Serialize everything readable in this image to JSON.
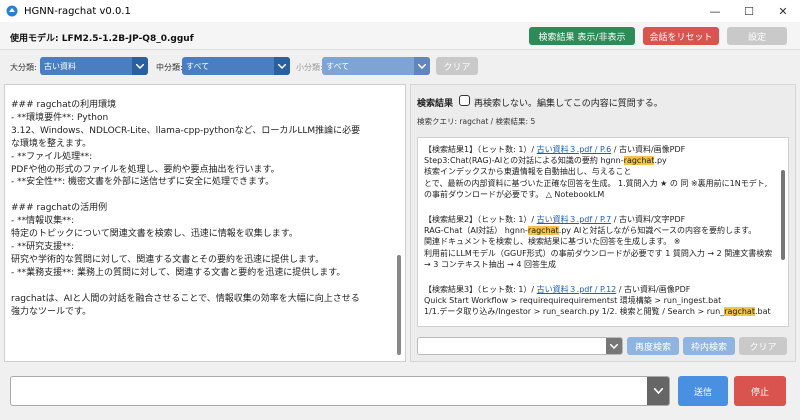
{
  "window": {
    "title": "HGNN-ragchat v0.0.1",
    "minimize": "—",
    "maximize": "☐",
    "close": "✕"
  },
  "toolbar": {
    "model_label": "使用モデル: LFM2.5-1.2B-JP-Q8_0.gguf",
    "toggle_results_label": "検索結果 表示/非表示",
    "reset_label": "会話をリセット",
    "settings_label": "設定"
  },
  "filters": {
    "major_label": "大分類:",
    "major_value": "古い資料",
    "middle_label": "中分類:",
    "middle_value": "すべて",
    "minor_label": "小分類:",
    "minor_value": "すべて",
    "clear_label": "クリア"
  },
  "answer": {
    "text": "### ragchatの利用環境\n- **環境要件**: Python\n3.12、Windows、NDLOCR-Lite、llama-cpp-pythonなど、ローカルLLM推論に必要\nな環境を整えます。\n- **ファイル処理**:\nPDFや他の形式のファイルを処理し、要約や要点抽出を行います。\n- **安全性**: 機密文書を外部に送信せずに安全に処理できます。\n\n### ragchatの活用例\n- **情報収集**:\n特定のトピックについて関連文書を検索し、迅速に情報を収集します。\n- **研究支援**:\n研究や学術的な質問に対して、関連する文書とその要約を迅速に提供します。\n- **業務支援**: 業務上の質問に対して、関連する文書と要約を迅速に提供します。\n\nragchatは、AIと人間の対話を融合させることで、情報収集の効率を大幅に向上させる\n強力なツールです。"
  },
  "results": {
    "heading": "検索結果",
    "checkbox_label": "再検索しない。編集してこの内容に質問する。",
    "query_info": "検索クエリ: ragchat / 検索結果: 5",
    "items": [
      {
        "prefix": "【検索結果1】（ヒット数: 1）/ ",
        "link": "古い資料３.pdf / P.6",
        "suffix": " / 古い資料/画像PDF",
        "l2a": "Step3:Chat(RAG)-AIとの対話による知識の要約 hgnn-",
        "l2hl": "ragchat",
        "l2b": ".py",
        "l3": "核索インデックスから東遺情報を自動抽出し、与えること",
        "l4": "とで、最新の内部資料に基づいた正確な回答を生成。 1.質問入力 ★ の 同 ※裏用前に1Nモデト,",
        "l5": "の事前ダウンロードが必要です。 △ NotebookLM"
      },
      {
        "prefix": "【検索結果2】（ヒット数: 1）/ ",
        "link": "古い資料３.pdf / P.7",
        "suffix": " / 古い資料/文字PDF",
        "l2a": "RAG-Chat（AI対話） hgnn-",
        "l2hl": "ragchat",
        "l2b": ".py AIと対話しながら知識ベースの内容を要約します。",
        "l3": "関連ドキュメントを検索し、検索結果に基づいた回答を生成します。 ※",
        "l4": "利用前にLLMモデル（GGUF形式）の事前ダウンロードが必要です 1 質問入力 → 2 関連文書検索",
        "l5": "→ 3 コンテキスト抽出 → 4 回答生成"
      },
      {
        "prefix": "【検索結果3】（ヒット数: 1）/ ",
        "link": "古い資料３.pdf / P.12",
        "suffix": " / 古い資料/画像PDF",
        "l2a": "Quick Start Workflow > requirequirequirementst 環境構築 > run_ingest.bat",
        "l2hl": "",
        "l2b": "",
        "l3a": "1/1.データ取り込み/Ingestor > run_search.py 1/2. 検索と閲覧 / Search > run_",
        "l3hl": "ragchat",
        "l3b": ".bat"
      }
    ],
    "search_input_value": "",
    "re_search_label": "再度検索",
    "in_search_label": "枠内検索",
    "clear_label": "クリア"
  },
  "composer": {
    "input_value": "",
    "send_label": "送信",
    "stop_label": "停止"
  },
  "colors": {
    "accent_blue": "#4a7ec0",
    "green": "#2e8b57",
    "red": "#d9534f",
    "highlight": "#f6c34a"
  }
}
